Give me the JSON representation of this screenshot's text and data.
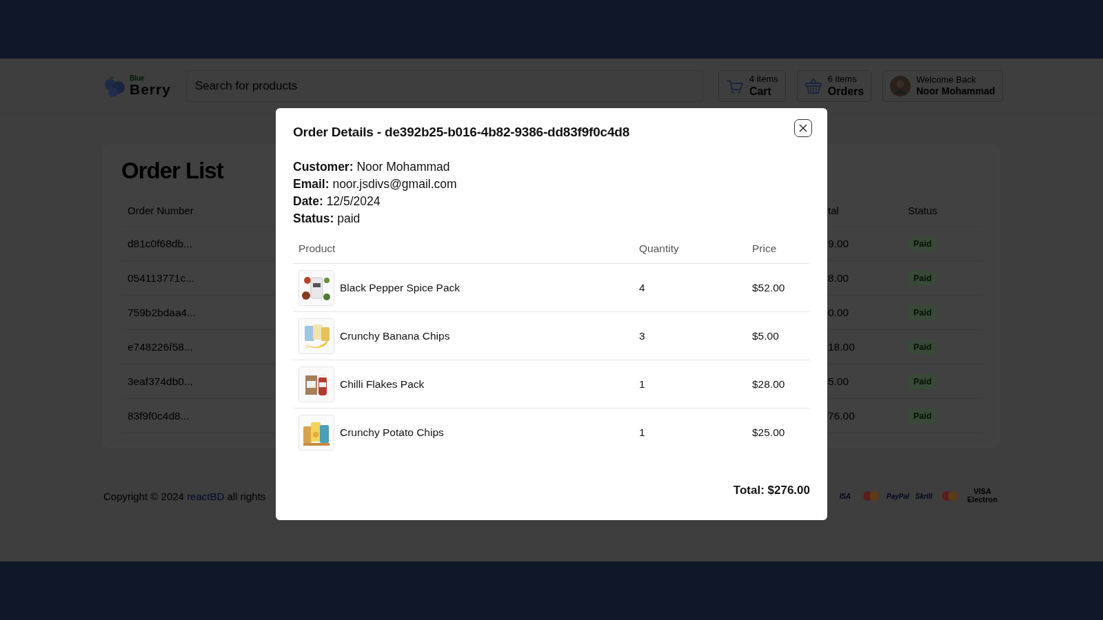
{
  "header": {
    "logo": {
      "tagline": "Blue",
      "name": "Berry"
    },
    "search": {
      "placeholder": "Search for products"
    },
    "cart": {
      "count": "4 items",
      "label": "Cart"
    },
    "orders": {
      "count": "6 items",
      "label": "Orders"
    },
    "user": {
      "greeting": "Welcome Back",
      "name": "Noor Mohammad"
    }
  },
  "order_list": {
    "title": "Order List",
    "columns": [
      "Order Number",
      "tal",
      "Status"
    ],
    "rows": [
      {
        "order_number": "d81c0f68db...",
        "column_2": "9.00",
        "status": "Paid"
      },
      {
        "order_number": "054113771c...",
        "column_2": "8.00",
        "status": "Paid"
      },
      {
        "order_number": "759b2bdaa4...",
        "column_2": "0.00",
        "status": "Paid"
      },
      {
        "order_number": "e748226f58...",
        "column_2": "18.00",
        "status": "Paid"
      },
      {
        "order_number": "3eaf374db0...",
        "column_2": "5.00",
        "status": "Paid"
      },
      {
        "order_number": "83f9f0c4d8...",
        "column_2": "76.00",
        "status": "Paid"
      }
    ]
  },
  "footer": {
    "copyright": "Copyright © 2024",
    "link": "reactBD",
    "rest": "all rights",
    "payments": [
      {
        "kind": "text",
        "label": "ISA"
      },
      {
        "kind": "circles"
      },
      {
        "kind": "text",
        "label": "PayPal"
      },
      {
        "kind": "text",
        "label": "Skrill"
      },
      {
        "kind": "circles"
      },
      {
        "kind": "text",
        "label": "VISA Electron"
      }
    ]
  },
  "modal": {
    "title": "Order Details - de392b25-b016-4b82-9386-dd83f9f0c4d8",
    "fields": [
      {
        "label": "Customer:",
        "value": "Noor Mohammad"
      },
      {
        "label": "Email:",
        "value": "noor.jsdivs@gmail.com"
      },
      {
        "label": "Date:",
        "value": "12/5/2024"
      },
      {
        "label": "Status:",
        "value": "paid"
      }
    ],
    "columns": [
      "Product",
      "Quantity",
      "Price"
    ],
    "items": [
      {
        "name": "Black Pepper Spice Pack",
        "quantity": "4",
        "price": "$52.00"
      },
      {
        "name": "Crunchy Banana Chips",
        "quantity": "3",
        "price": "$5.00"
      },
      {
        "name": "Chilli Flakes Pack",
        "quantity": "1",
        "price": "$28.00"
      },
      {
        "name": "Crunchy Potato Chips",
        "quantity": "1",
        "price": "$25.00"
      }
    ],
    "total": "Total: $276.00"
  }
}
